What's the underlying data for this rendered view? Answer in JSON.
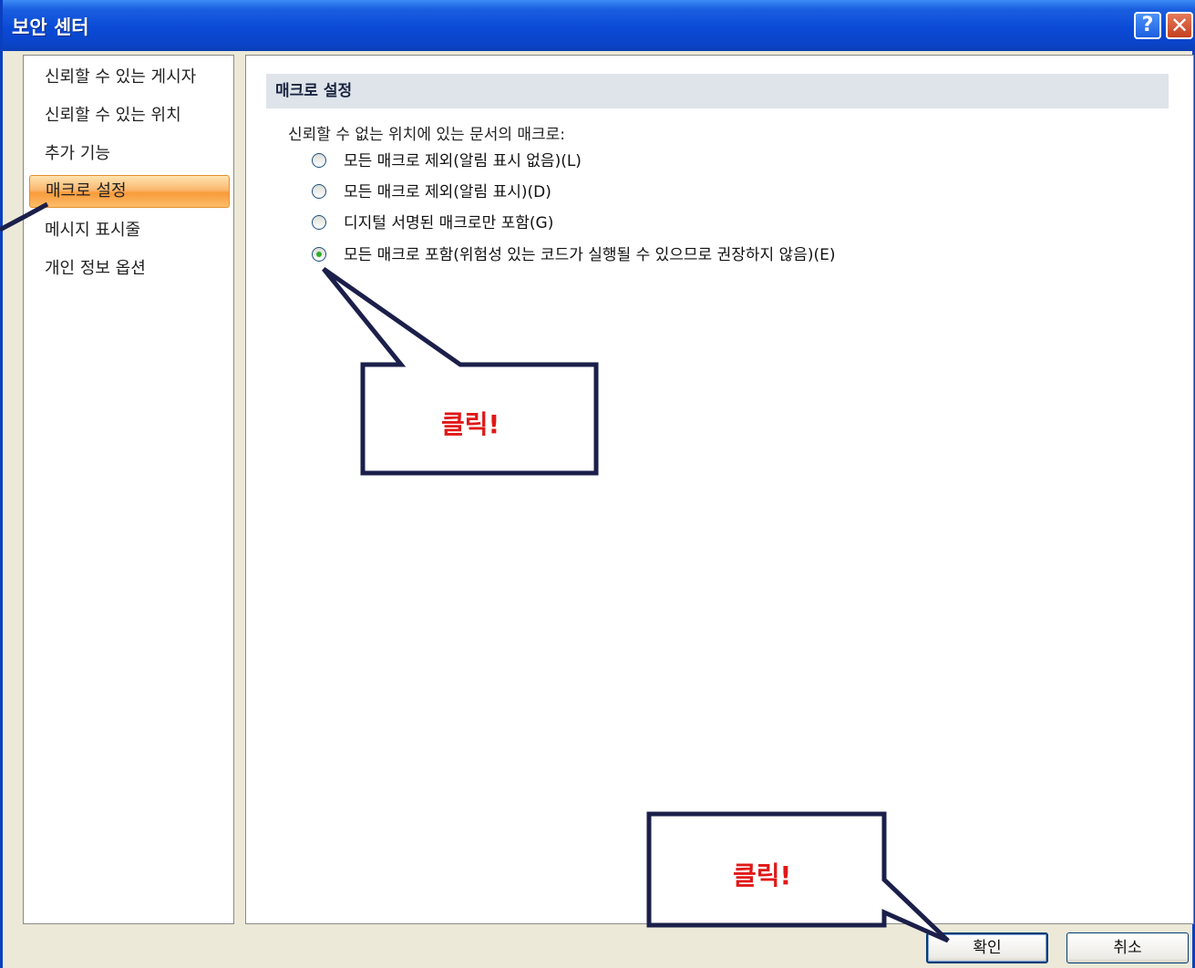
{
  "window": {
    "title": "보안 센터",
    "help_glyph": "?",
    "close_glyph": "✕"
  },
  "sidebar": {
    "items": [
      {
        "label": "신뢰할 수 있는 게시자"
      },
      {
        "label": "신뢰할 수 있는 위치"
      },
      {
        "label": "추가 기능"
      },
      {
        "label": "매크로 설정",
        "selected": true
      },
      {
        "label": "메시지 표시줄"
      },
      {
        "label": "개인 정보 옵션"
      }
    ]
  },
  "main": {
    "section_title": "매크로 설정",
    "group_label": "신뢰할 수 없는 위치에 있는 문서의 매크로:",
    "options": [
      {
        "label": "모든 매크로 제외(알림 표시 없음)(L)",
        "checked": false
      },
      {
        "label": "모든 매크로 제외(알림 표시)(D)",
        "checked": false
      },
      {
        "label": "디지털 서명된 매크로만 포함(G)",
        "checked": false
      },
      {
        "label": "모든 매크로 포함(위험성 있는 코드가 실행될 수 있으므로 권장하지 않음)(E)",
        "checked": true
      }
    ]
  },
  "footer": {
    "ok_label": "확인",
    "cancel_label": "취소"
  },
  "callouts": [
    {
      "text": "클릭!"
    },
    {
      "text": "클릭!"
    }
  ],
  "colors": {
    "accent": "#0a44c9",
    "selected_item": "#f89b3b",
    "callout_text": "#e01818",
    "callout_border": "#1b1f4a"
  }
}
